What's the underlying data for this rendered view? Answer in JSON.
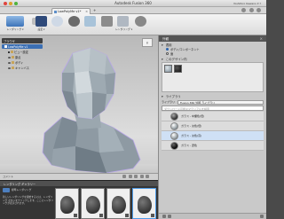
{
  "window": {
    "title": "Autodesk Fusion 360",
    "user": "Yoshihiro Kawano ▾ ?"
  },
  "tab": {
    "label": "LowPolyMe v1*",
    "close": "×",
    "add": "+"
  },
  "toolbar": {
    "items": [
      {
        "label": "レンダリング ▾"
      },
      {
        "label": ""
      },
      {
        "label": "設定 ▾"
      },
      {
        "label": ""
      },
      {
        "label": ""
      },
      {
        "label": ""
      },
      {
        "label": ""
      },
      {
        "label": "レンダリング ▾"
      },
      {
        "label": ""
      }
    ]
  },
  "browser": {
    "header": "ブラウザ",
    "root": "LowPolyMe v1",
    "items": [
      "ビュー設定",
      "原点",
      "ボディ",
      "キャンバス"
    ]
  },
  "viewcube": {
    "label": "前"
  },
  "viewport_bar": {
    "label": "コメント"
  },
  "gallery": {
    "title": "レンダリング ギャラリー",
    "subtitle": "標準レンダリング",
    "description": "新しいレンダリングを開始するには、レンダリング ボタンをクリックします。ここにレンダリングが表示されます。"
  },
  "panel": {
    "title": "外観",
    "sections": {
      "apply": "適用",
      "in_design": "このデザイン内",
      "library": "ライブラリ"
    },
    "apply_options": [
      "ボディ/コンポーネント",
      "面"
    ],
    "library_label": "ライブラリ",
    "library_value": "Fusion 360 外観 ライブラリ",
    "search_placeholder": "ダウンロード可能なマテリアルを検索",
    "materials": [
      {
        "label": "ガラス - 中煙色(低)",
        "kind": "smoke"
      },
      {
        "label": "ガラス - 淡色(低)",
        "kind": "glass"
      },
      {
        "label": "ガラス - 淡色(高)",
        "kind": "glass"
      },
      {
        "label": "ガラス - 濃色",
        "kind": "dark"
      }
    ]
  },
  "colors": {
    "accent": "#3b6fb4",
    "selection": "#4d9be8",
    "panel_bg": "#c9c9c9",
    "viewport_bg": "#d3d3d3"
  }
}
